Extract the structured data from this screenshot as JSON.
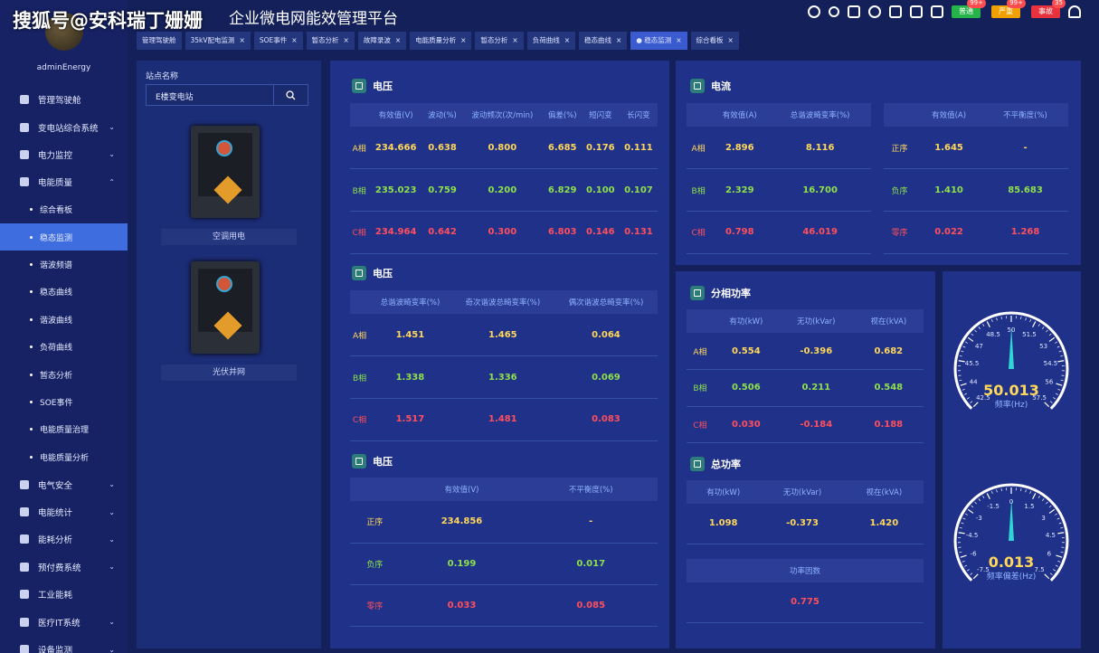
{
  "watermark": "搜狐号@安科瑞丁姗姗",
  "app_title": "企业微电网能效管理平台",
  "user": "adminEnergy",
  "menu": [
    {
      "label": "管理驾驶舱",
      "icon": "monitor-icon",
      "chev": ""
    },
    {
      "label": "变电站综合系统",
      "icon": "home-icon",
      "chev": "⌄"
    },
    {
      "label": "电力监控",
      "icon": "power-icon",
      "chev": "⌄"
    },
    {
      "label": "电能质量",
      "icon": "quality-icon",
      "chev": "⌃"
    },
    {
      "label": "综合看板",
      "sub": true
    },
    {
      "label": "稳态监测",
      "sub": true,
      "active": true
    },
    {
      "label": "谐波频谱",
      "sub": true
    },
    {
      "label": "稳态曲线",
      "sub": true
    },
    {
      "label": "谐波曲线",
      "sub": true
    },
    {
      "label": "负荷曲线",
      "sub": true
    },
    {
      "label": "暂态分析",
      "sub": true
    },
    {
      "label": "SOE事件",
      "sub": true
    },
    {
      "label": "电能质量治理",
      "sub": true
    },
    {
      "label": "电能质量分析",
      "sub": true
    },
    {
      "label": "电气安全",
      "icon": "safety-icon",
      "chev": "⌄"
    },
    {
      "label": "电能统计",
      "icon": "chart-icon",
      "chev": "⌄"
    },
    {
      "label": "能耗分析",
      "icon": "analysis-icon",
      "chev": "⌄"
    },
    {
      "label": "预付费系统",
      "icon": "prepay-icon",
      "chev": "⌄"
    },
    {
      "label": "工业能耗",
      "icon": "factory-icon",
      "chev": ""
    },
    {
      "label": "医疗IT系统",
      "icon": "medical-icon",
      "chev": "⌄"
    },
    {
      "label": "设备监测",
      "icon": "device-icon",
      "chev": "⌄"
    }
  ],
  "badges": [
    {
      "label": "普通",
      "count": "99+",
      "color": "#26b34a"
    },
    {
      "label": "严重",
      "count": "99+",
      "color": "#f0a000"
    },
    {
      "label": "事故",
      "count": "35",
      "color": "#e8333f"
    }
  ],
  "tabs": [
    {
      "label": "管理驾驶舱",
      "close": ""
    },
    {
      "label": "35kV配电监测",
      "close": "×"
    },
    {
      "label": "SOE事件",
      "close": "×"
    },
    {
      "label": "暂态分析",
      "close": "×"
    },
    {
      "label": "故障录波",
      "close": "×"
    },
    {
      "label": "电能质量分析",
      "close": "×"
    },
    {
      "label": "暂态分析",
      "close": "×"
    },
    {
      "label": "负荷曲线",
      "close": "×"
    },
    {
      "label": "稳态曲线",
      "close": "×"
    },
    {
      "label": "● 稳态监测",
      "close": "×",
      "active": true
    },
    {
      "label": "综合看板",
      "close": "×"
    }
  ],
  "station": {
    "label": "站点名称",
    "value": "E楼变电站"
  },
  "devices": [
    "空调用电",
    "光伏并网"
  ],
  "voltage1": {
    "title": "电压",
    "headers": [
      "",
      "有效值(V)",
      "波动(%)",
      "波动频次(次/min)",
      "偏差(%)",
      "短闪变",
      "长闪变"
    ],
    "rows": [
      {
        "phase": "A相",
        "cls": "y",
        "vals": [
          "234.666",
          "0.638",
          "0.800",
          "6.685",
          "0.176",
          "0.111"
        ]
      },
      {
        "phase": "B相",
        "cls": "g",
        "vals": [
          "235.023",
          "0.759",
          "0.200",
          "6.829",
          "0.100",
          "0.107"
        ]
      },
      {
        "phase": "C相",
        "cls": "r",
        "vals": [
          "234.964",
          "0.642",
          "0.300",
          "6.803",
          "0.146",
          "0.131"
        ]
      }
    ]
  },
  "voltage2": {
    "title": "电压",
    "headers": [
      "",
      "总谐波畸变率(%)",
      "奇次谐波总畸变率(%)",
      "偶次谐波总畸变率(%)"
    ],
    "rows": [
      {
        "phase": "A相",
        "cls": "y",
        "vals": [
          "1.451",
          "1.465",
          "0.064"
        ]
      },
      {
        "phase": "B相",
        "cls": "g",
        "vals": [
          "1.338",
          "1.336",
          "0.069"
        ]
      },
      {
        "phase": "C相",
        "cls": "r",
        "vals": [
          "1.517",
          "1.481",
          "0.083"
        ]
      }
    ]
  },
  "voltage3": {
    "title": "电压",
    "headers": [
      "",
      "有效值(V)",
      "不平衡度(%)"
    ],
    "rows": [
      {
        "phase": "正序",
        "cls": "y",
        "vals": [
          "234.856",
          "-"
        ]
      },
      {
        "phase": "负序",
        "cls": "g",
        "vals": [
          "0.199",
          "0.017"
        ]
      },
      {
        "phase": "零序",
        "cls": "r",
        "vals": [
          "0.033",
          "0.085"
        ]
      }
    ]
  },
  "current": {
    "title": "电流",
    "headers_left": [
      "",
      "有效值(A)",
      "总谐波畸变率(%)"
    ],
    "rows_left": [
      {
        "phase": "A相",
        "cls": "y",
        "vals": [
          "2.896",
          "8.116"
        ]
      },
      {
        "phase": "B相",
        "cls": "g",
        "vals": [
          "2.329",
          "16.700"
        ]
      },
      {
        "phase": "C相",
        "cls": "r",
        "vals": [
          "0.798",
          "46.019"
        ]
      }
    ],
    "headers_right": [
      "",
      "有效值(A)",
      "不平衡度(%)"
    ],
    "rows_right": [
      {
        "phase": "正序",
        "cls": "y",
        "vals": [
          "1.645",
          "-"
        ]
      },
      {
        "phase": "负序",
        "cls": "g",
        "vals": [
          "1.410",
          "85.683"
        ]
      },
      {
        "phase": "零序",
        "cls": "r",
        "vals": [
          "0.022",
          "1.268"
        ]
      }
    ]
  },
  "phase_power": {
    "title": "分相功率",
    "headers": [
      "",
      "有功(kW)",
      "无功(kVar)",
      "视在(kVA)"
    ],
    "rows": [
      {
        "phase": "A相",
        "cls": "y",
        "vals": [
          "0.554",
          "-0.396",
          "0.682"
        ]
      },
      {
        "phase": "B相",
        "cls": "g",
        "vals": [
          "0.506",
          "0.211",
          "0.548"
        ]
      },
      {
        "phase": "C相",
        "cls": "r",
        "vals": [
          "0.030",
          "-0.184",
          "0.188"
        ]
      }
    ]
  },
  "total_power": {
    "title": "总功率",
    "headers": [
      "有功(kW)",
      "无功(kVar)",
      "视在(kVA)"
    ],
    "vals": [
      "1.098",
      "-0.373",
      "1.420"
    ],
    "pf_label": "功率因数",
    "pf_value": "0.775"
  },
  "gauge_freq": {
    "value": "50.013",
    "label": "频率(Hz)",
    "min": 42.5,
    "max": 57.5,
    "ticks": [
      "42.5",
      "44",
      "45.5",
      "47",
      "48.5",
      "50",
      "51.5",
      "53",
      "54.5",
      "56",
      "57.5"
    ],
    "accent": "#ffd75a"
  },
  "gauge_dev": {
    "value": "0.013",
    "label": "频率偏差(Hz)",
    "min": -7.5,
    "max": 7.5,
    "ticks": [
      "-7.5",
      "-6",
      "-4.5",
      "-3",
      "-1.5",
      "0",
      "1.5",
      "3",
      "4.5",
      "6",
      "7.5"
    ],
    "accent": "#ffd75a"
  }
}
